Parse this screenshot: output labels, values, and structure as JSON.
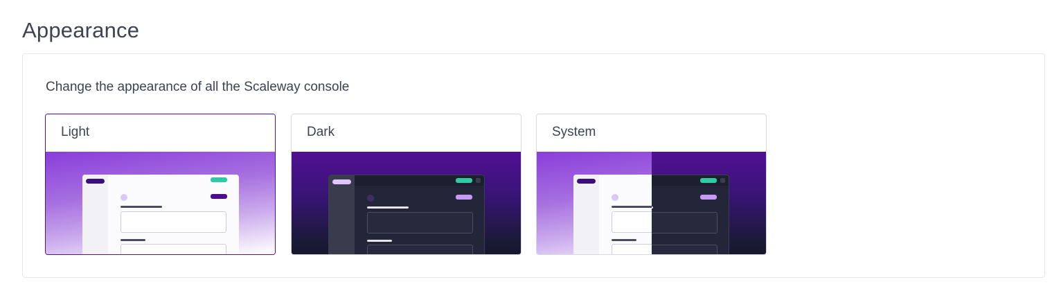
{
  "page": {
    "title": "Appearance"
  },
  "appearance": {
    "description": "Change the appearance of all the Scaleway console",
    "selected": "Light",
    "options": [
      {
        "label": "Light"
      },
      {
        "label": "Dark"
      },
      {
        "label": "System"
      }
    ]
  },
  "colors": {
    "selected_border": "#521094",
    "accent_green": "#2fcba6",
    "brand_purple": "#521094"
  }
}
